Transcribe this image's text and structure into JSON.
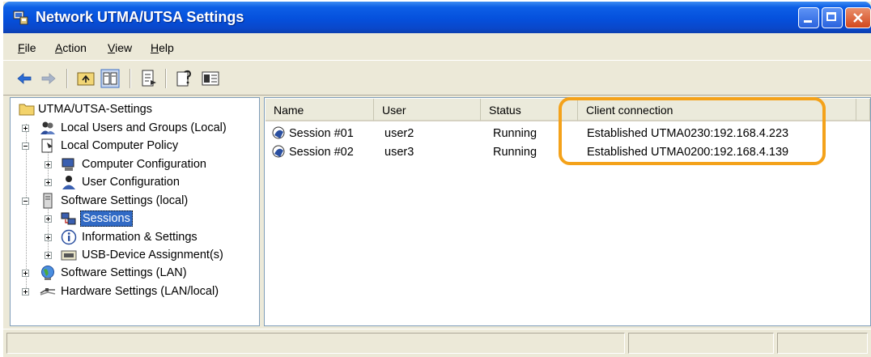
{
  "window": {
    "title": "Network UTMA/UTSA Settings",
    "accent": "#0550dc",
    "highlight_color": "#f4a21a"
  },
  "menubar": {
    "items": [
      {
        "label": "File",
        "accel": "F",
        "rest": "ile"
      },
      {
        "label": "Action",
        "accel": "A",
        "rest": "ction"
      },
      {
        "label": "View",
        "accel": "V",
        "rest": "iew"
      },
      {
        "label": "Help",
        "accel": "H",
        "rest": "elp"
      }
    ]
  },
  "toolbar": {
    "icons": [
      "back-arrow-icon",
      "forward-arrow-icon",
      "up-one-level-icon",
      "show-hide-tree-icon",
      "export-list-icon",
      "help-icon",
      "properties-icon"
    ]
  },
  "tree": {
    "root": "UTMA/UTSA-Settings",
    "items": [
      {
        "label": "Local Users and Groups (Local)",
        "icon": "users-icon"
      },
      {
        "label": "Local Computer Policy",
        "icon": "policy-icon"
      },
      {
        "label": "Computer Configuration",
        "icon": "computer-config-icon"
      },
      {
        "label": "User Configuration",
        "icon": "user-config-icon"
      },
      {
        "label": "Software Settings (local)",
        "icon": "server-icon"
      },
      {
        "label": "Sessions",
        "icon": "sessions-icon",
        "selected": true
      },
      {
        "label": "Information & Settings",
        "icon": "info-icon"
      },
      {
        "label": "USB-Device Assignment(s)",
        "icon": "usb-icon"
      },
      {
        "label": "Software Settings (LAN)",
        "icon": "globe-icon"
      },
      {
        "label": "Hardware Settings (LAN/local)",
        "icon": "network-cable-icon"
      }
    ]
  },
  "list": {
    "columns": [
      "Name",
      "User",
      "Status",
      "Client connection"
    ],
    "rows": [
      {
        "name": "Session #01",
        "user": "user2",
        "status": "Running",
        "client": "Established UTMA0230:192.168.4.223"
      },
      {
        "name": "Session #02",
        "user": "user3",
        "status": "Running",
        "client": "Established UTMA0200:192.168.4.139"
      }
    ]
  }
}
